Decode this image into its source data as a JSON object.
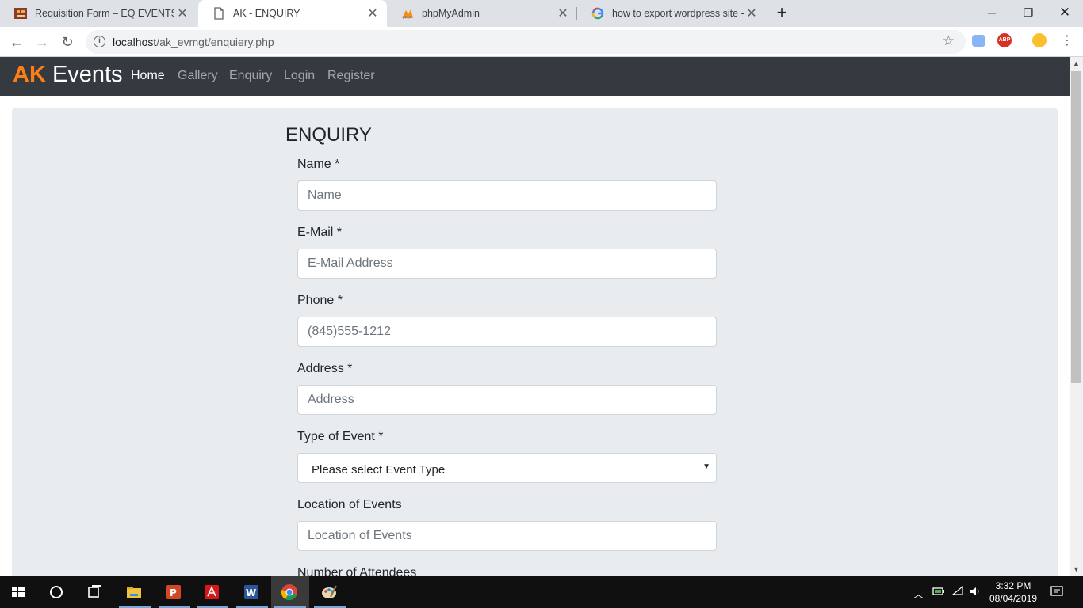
{
  "browser": {
    "tabs": [
      {
        "title": "Requisition Form – EQ EVENTS",
        "favicon": "form-favicon"
      },
      {
        "title": "AK - ENQUIRY",
        "favicon": "page-favicon",
        "active": true
      },
      {
        "title": "phpMyAdmin",
        "favicon": "phpmyadmin-favicon"
      },
      {
        "title": "how to export wordpress site - G",
        "favicon": "google-favicon"
      }
    ],
    "new_tab": "+",
    "url_host": "localhost",
    "url_path": "/ak_evmgt/enquiery.php"
  },
  "navbar": {
    "brand_accent": "AK",
    "brand_rest": " Events",
    "links": [
      "Home",
      "Gallery",
      "Enquiry",
      "Login",
      "Register"
    ],
    "active": "Home"
  },
  "form": {
    "title": "ENQUIRY",
    "name": {
      "label": "Name *",
      "placeholder": "Name"
    },
    "email": {
      "label": "E-Mail *",
      "placeholder": "E-Mail Address"
    },
    "phone": {
      "label": "Phone *",
      "placeholder": "(845)555-1212"
    },
    "address": {
      "label": "Address *",
      "placeholder": "Address"
    },
    "event_type": {
      "label": "Type of Event *",
      "selected": "Please select Event Type"
    },
    "location": {
      "label": "Location of Events",
      "placeholder": "Location of Events"
    },
    "attendees": {
      "label": "Number of Attendees"
    }
  },
  "taskbar": {
    "time": "3:32 PM",
    "date": "08/04/2019",
    "apps": [
      "file-explorer",
      "powerpoint",
      "acrobat",
      "word",
      "chrome",
      "paint"
    ]
  },
  "colors": {
    "navbar_bg": "#343a40",
    "brand_accent": "#fd7e14",
    "jumbotron_bg": "#e9ecef"
  }
}
